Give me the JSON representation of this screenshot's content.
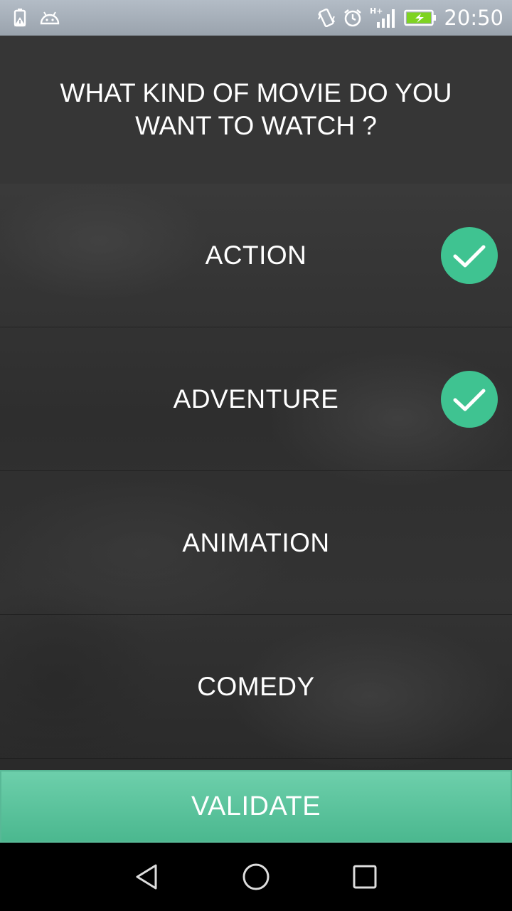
{
  "status_bar": {
    "time": "20:50",
    "icons": [
      "battery-saver-icon",
      "android-icon",
      "vibrate-icon",
      "alarm-icon",
      "signal-hplus-icon",
      "battery-charging-icon"
    ]
  },
  "header": {
    "title": "WHAT KIND OF MOVIE DO YOU WANT TO WATCH ?"
  },
  "genres": [
    {
      "label": "ACTION",
      "selected": true
    },
    {
      "label": "ADVENTURE",
      "selected": true
    },
    {
      "label": "ANIMATION",
      "selected": false
    },
    {
      "label": "COMEDY",
      "selected": false
    }
  ],
  "validate": {
    "label": "VALIDATE"
  },
  "nav": {
    "icons": [
      "back-icon",
      "home-icon",
      "recents-icon"
    ]
  },
  "colors": {
    "accent": "#3fc391",
    "button": "#5cc49e",
    "header_bg": "#363636",
    "status_bar": "#a9b2bc"
  }
}
